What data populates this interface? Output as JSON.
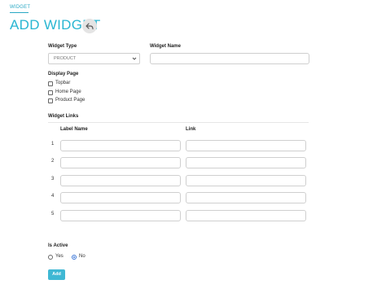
{
  "breadcrumb": {
    "tab_label": "WIDGET"
  },
  "header": {
    "title": "ADD WIDGET"
  },
  "form": {
    "widget_type": {
      "label": "Widget Type",
      "selected": "PRODUCT"
    },
    "widget_name": {
      "label": "Widget Name",
      "value": ""
    },
    "display_page": {
      "label": "Display Page",
      "options": [
        {
          "label": "Topbar",
          "checked": false
        },
        {
          "label": "Home Page",
          "checked": false
        },
        {
          "label": "Product Page",
          "checked": false
        }
      ]
    },
    "widget_links": {
      "label": "Widget Links",
      "col_label_name": "Label Name",
      "col_link": "Link",
      "rows": [
        {
          "num": "1",
          "label_name": "",
          "link": ""
        },
        {
          "num": "2",
          "label_name": "",
          "link": ""
        },
        {
          "num": "3",
          "label_name": "",
          "link": ""
        },
        {
          "num": "4",
          "label_name": "",
          "link": ""
        },
        {
          "num": "5",
          "label_name": "",
          "link": ""
        }
      ]
    },
    "is_active": {
      "label": "Is Active",
      "options": [
        {
          "label": "Yes",
          "checked": false
        },
        {
          "label": "No",
          "checked": true
        }
      ]
    },
    "submit_label": "Add"
  },
  "colors": {
    "accent": "#29b6d2",
    "button": "#3fb8d4",
    "radio_checked": "#3b76d8"
  },
  "icons": {
    "back": "back-arrow-icon",
    "select": "chevron-down-icon"
  }
}
